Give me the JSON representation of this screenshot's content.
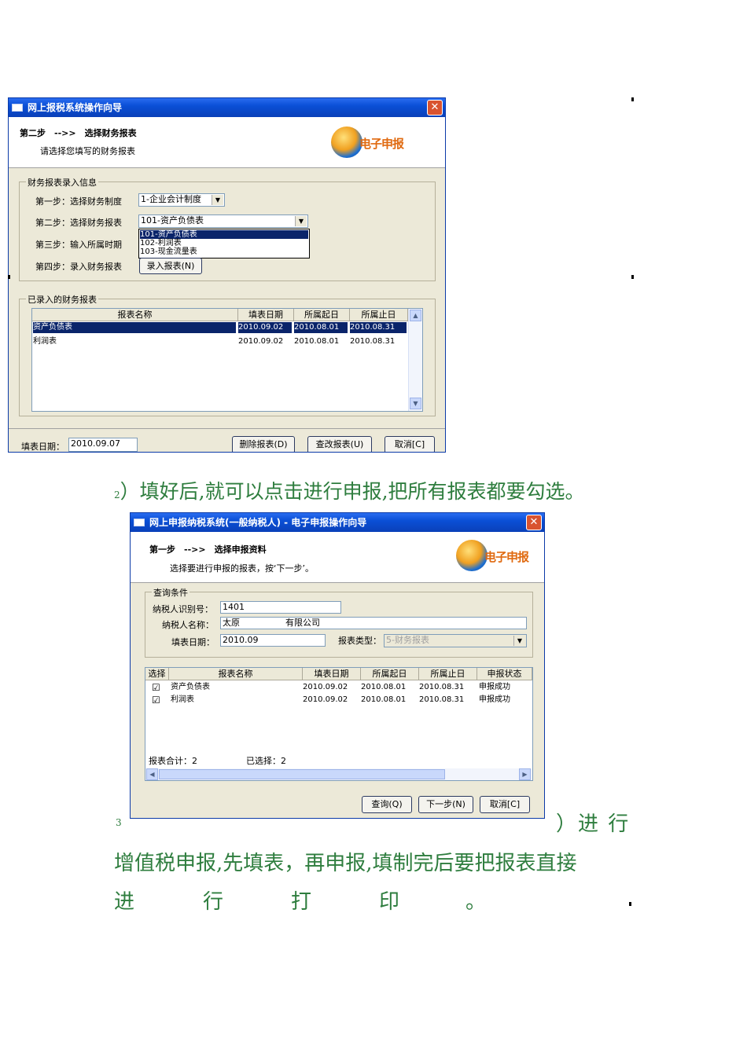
{
  "win1": {
    "title": "网上报税系统操作向导",
    "close": "✕",
    "step": "第二步　-->>　选择财务报表",
    "hint": "请选择您填写的财务报表",
    "logo_text": "电子申报",
    "group1_label": "财务报表录入信息",
    "row1_label": "第一步：选择财务制度",
    "row1_value": "1-企业会计制度",
    "row2_label": "第二步：选择财务报表",
    "row2_value": "101-资产负债表",
    "dropdown_options": [
      "101-资产负债表",
      "102-利润表",
      "103-现金流量表"
    ],
    "row3_label": "第三步：输入所属时期",
    "row4_label": "第四步：录入财务报表",
    "entry_button": "录入报表(N)",
    "group2_label": "已录入的财务报表",
    "columns": [
      "报表名称",
      "填表日期",
      "所属起日",
      "所属止日"
    ],
    "rows": [
      [
        "资产负债表",
        "2010.09.02",
        "2010.08.01",
        "2010.08.31"
      ],
      [
        "利润表",
        "2010.09.02",
        "2010.08.01",
        "2010.08.31"
      ]
    ],
    "fill_date_label": "填表日期：",
    "fill_date_value": "2010.09.07",
    "delete_button": "删除报表(D)",
    "modify_button": "查改报表(U)",
    "cancel_button": "取消[C]"
  },
  "para1": "2）填好后,就可以点击进行申报,把所有报表都要勾选。",
  "para1_num": "2",
  "para1_text": "）填好后,就可以点击进行申报,把所有报表都要勾选。",
  "win2": {
    "title": "网上申报纳税系统(一般纳税人) - 电子申报操作向导",
    "close": "✕",
    "step": "第一步　-->>　选择申报资料",
    "hint": "选择要进行申报的报表，按‘下一步’。",
    "logo_text": "电子申报",
    "group_label": "查询条件",
    "taxid_label": "纳税人识别号：",
    "taxid_value": "1401",
    "name_label": "纳税人名称：",
    "name_value_a": "太原",
    "name_value_b": "有限公司",
    "date_label": "填表日期：",
    "date_value": "2010.09",
    "type_label": "报表类型：",
    "type_value": "5-财务报表",
    "columns": [
      "选择",
      "报表名称",
      "填表日期",
      "所属起日",
      "所属止日",
      "申报状态"
    ],
    "rows": [
      [
        "☑",
        "资产负债表",
        "2010.09.02",
        "2010.08.01",
        "2010.08.31",
        "申报成功"
      ],
      [
        "☑",
        "利润表",
        "2010.09.02",
        "2010.08.01",
        "2010.08.31",
        "申报成功"
      ]
    ],
    "total_label": "报表合计：2",
    "selected_label": "已选择：2",
    "query_button": "查询(Q)",
    "next_button": "下一步(N)",
    "cancel_button": "取消[C]"
  },
  "para2_num": "3",
  "para2_line1": "）进  行",
  "para2_line2": "增值税申报,先填表，再申报,填制完后要把报表直接",
  "para2_line3": [
    "进",
    "行",
    "打",
    "印",
    "。"
  ]
}
